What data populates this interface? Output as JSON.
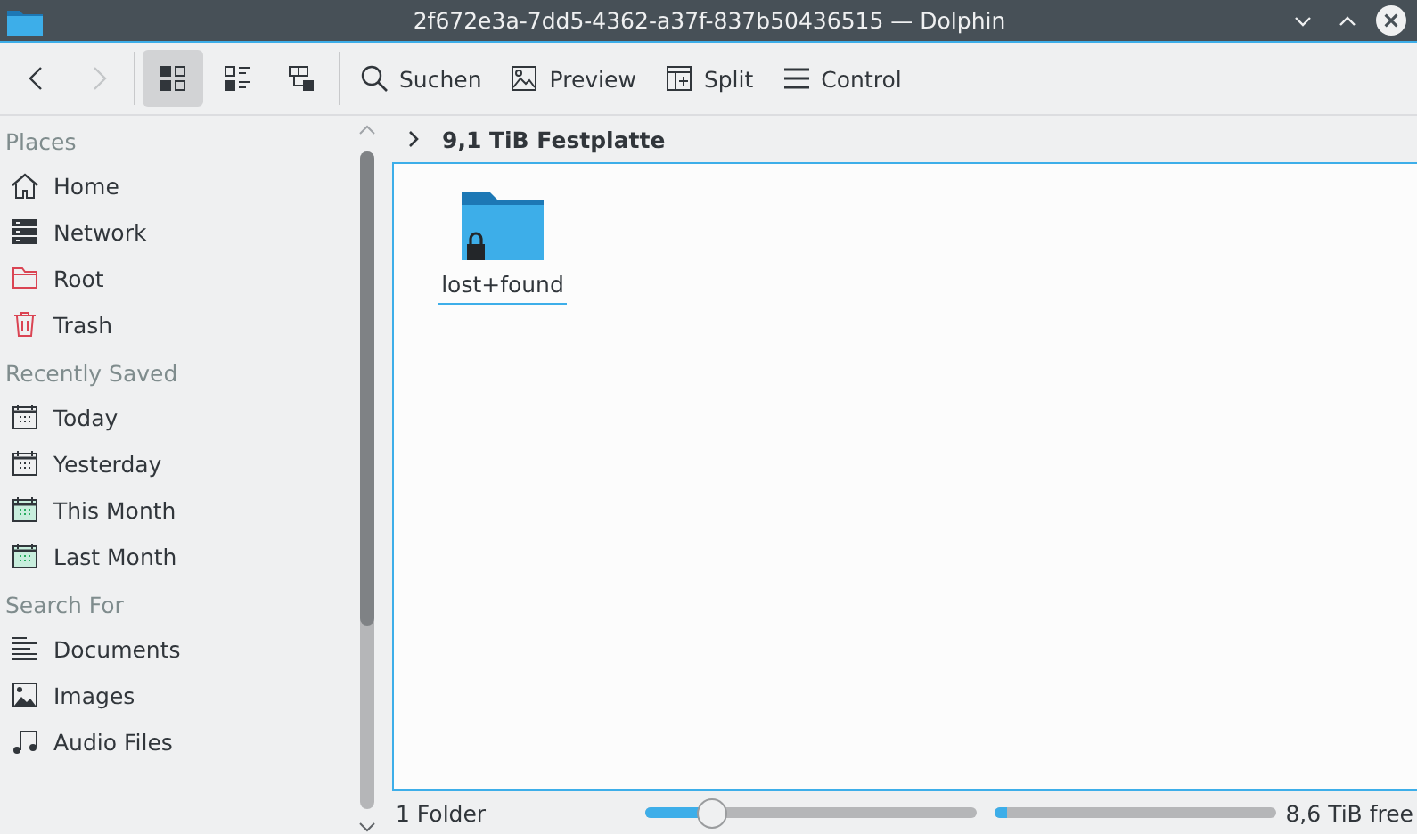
{
  "window": {
    "title": "2f672e3a-7dd5-4362-a37f-837b50436515 — Dolphin"
  },
  "toolbar": {
    "navigation": [
      {
        "kind": "back",
        "disabled": false
      },
      {
        "kind": "forward",
        "disabled": true
      }
    ],
    "view_modes": [
      {
        "kind": "icons",
        "selected": true
      },
      {
        "kind": "compact",
        "selected": false
      },
      {
        "kind": "details",
        "selected": false
      }
    ],
    "actions": [
      {
        "kind": "search",
        "label": "Suchen"
      },
      {
        "kind": "preview",
        "label": "Preview"
      },
      {
        "kind": "split",
        "label": "Split"
      },
      {
        "kind": "menu",
        "label": "Control"
      }
    ]
  },
  "sidebar": {
    "sections": [
      {
        "title": "Places",
        "items": [
          {
            "kind": "home",
            "label": "Home"
          },
          {
            "kind": "network",
            "label": "Network"
          },
          {
            "kind": "root",
            "label": "Root"
          },
          {
            "kind": "trash",
            "label": "Trash"
          }
        ]
      },
      {
        "title": "Recently Saved",
        "items": [
          {
            "kind": "calendar",
            "label": "Today"
          },
          {
            "kind": "calendar",
            "label": "Yesterday"
          },
          {
            "kind": "calendar-month",
            "label": "This Month"
          },
          {
            "kind": "calendar-month",
            "label": "Last Month"
          }
        ]
      },
      {
        "title": "Search For",
        "items": [
          {
            "kind": "documents",
            "label": "Documents"
          },
          {
            "kind": "images",
            "label": "Images"
          },
          {
            "kind": "audio",
            "label": "Audio Files"
          }
        ]
      }
    ]
  },
  "breadcrumb": {
    "path": "9,1 TiB Festplatte"
  },
  "files": [
    {
      "name": "lost+found",
      "kind": "folder",
      "locked": true,
      "selected": false
    }
  ],
  "status_bar": {
    "summary": "1 Folder",
    "zoom": {
      "level": 0.2
    },
    "disk": {
      "level": 0.04
    },
    "free_space": "8,6 TiB free"
  }
}
